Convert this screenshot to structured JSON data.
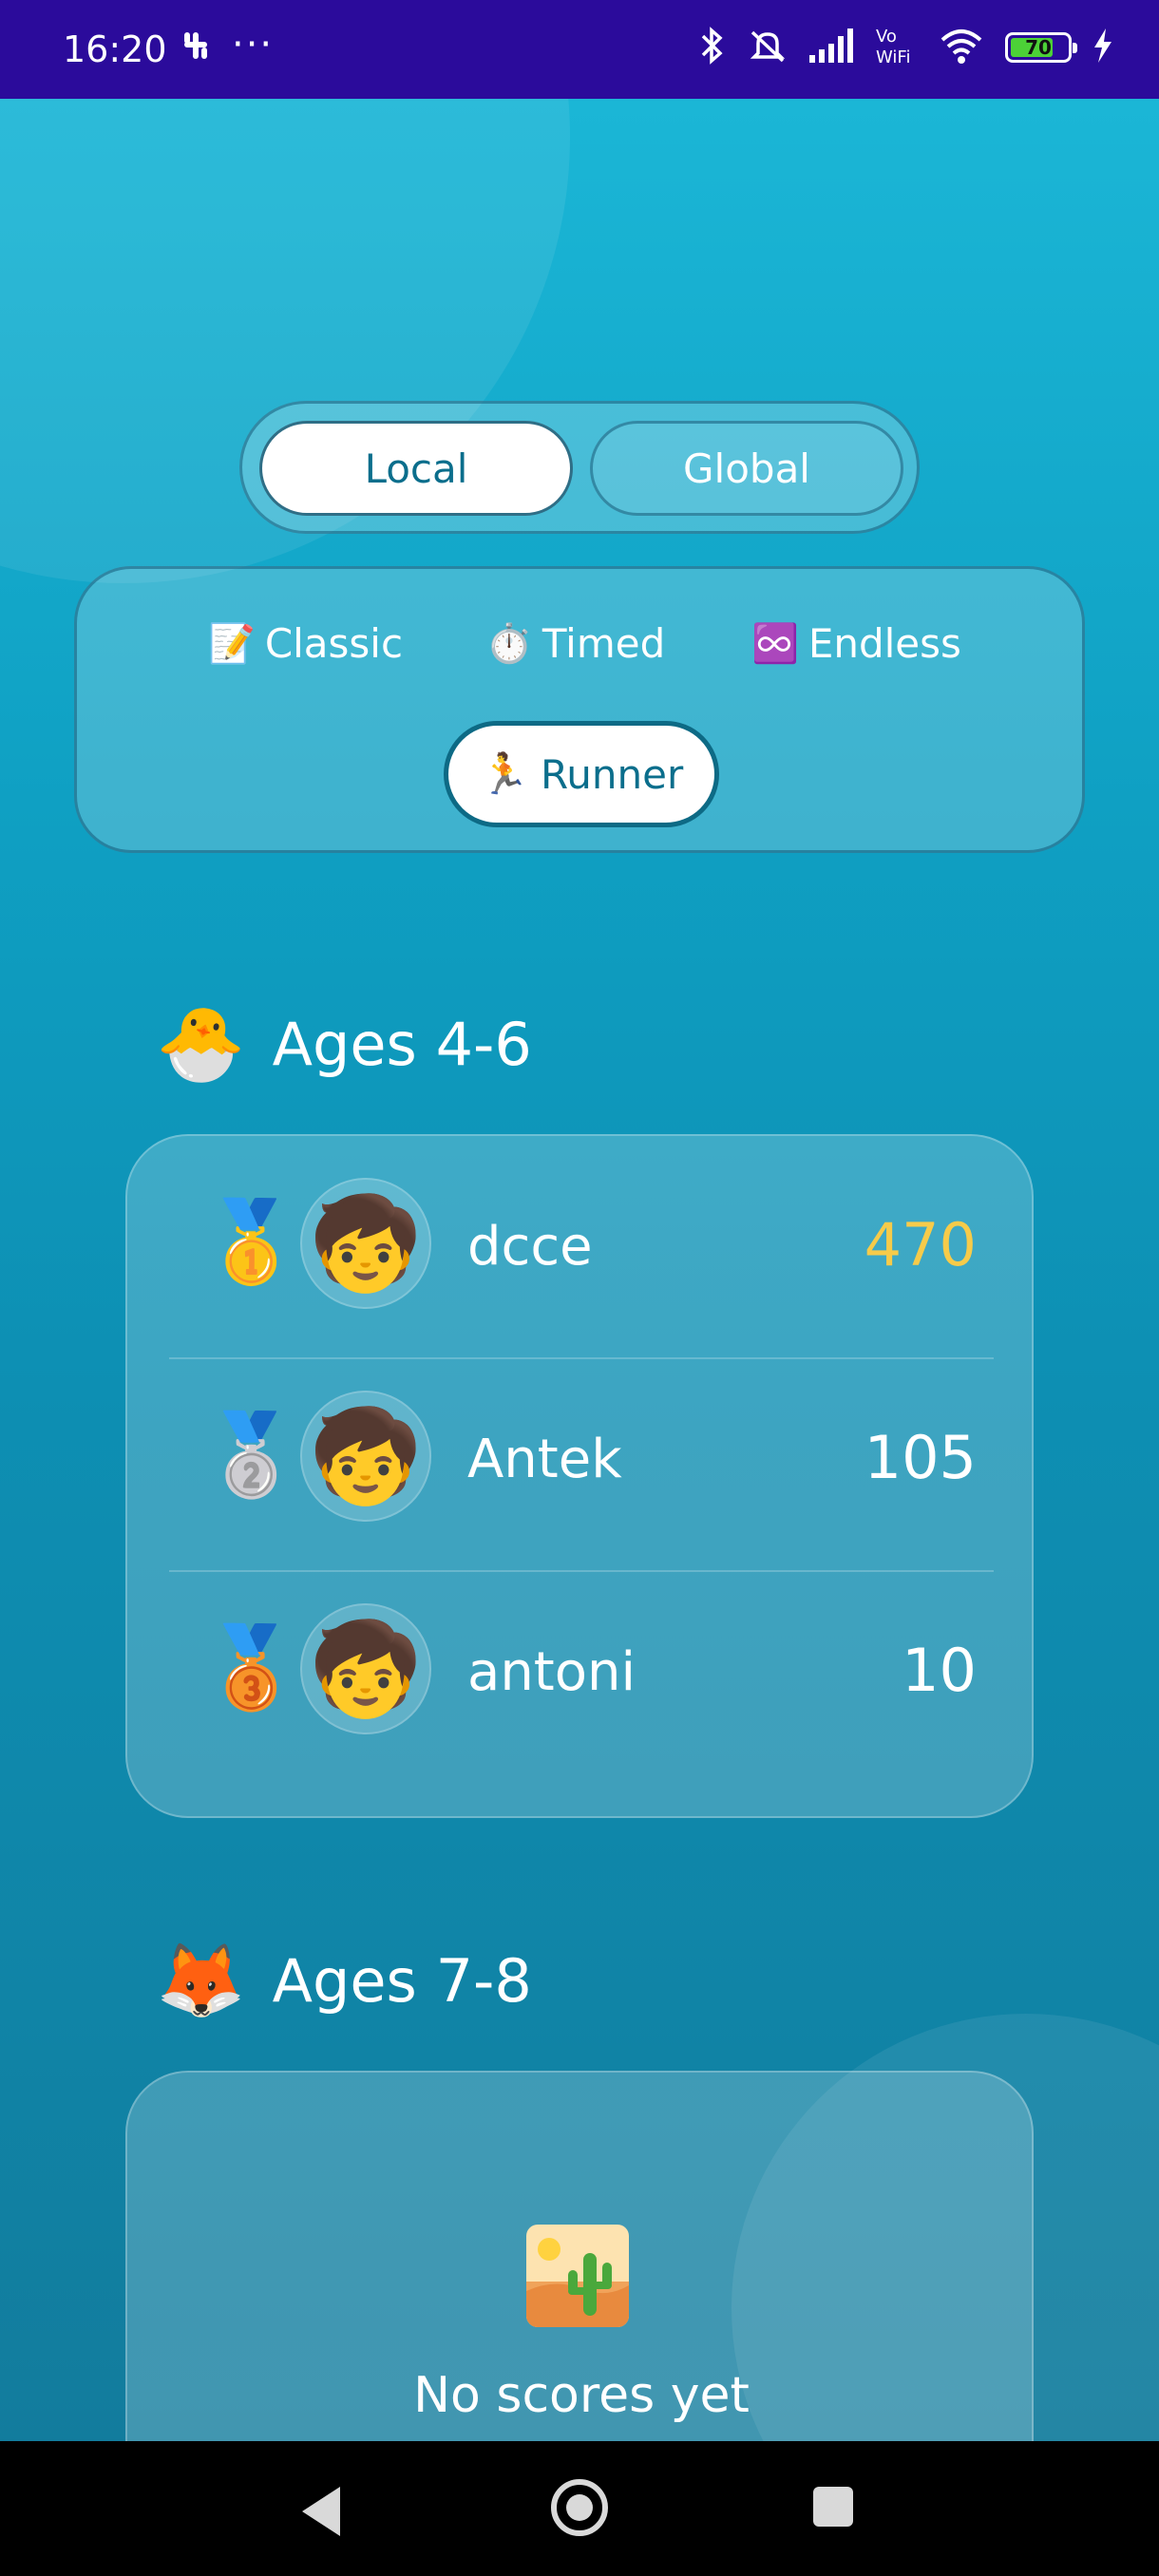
{
  "status_bar": {
    "time": "16:20",
    "overflow": "···",
    "battery": "70"
  },
  "toggle": {
    "local": "Local",
    "global": "Global"
  },
  "modes": [
    {
      "icon": "📝",
      "label": "Classic"
    },
    {
      "icon": "⏱️",
      "label": "Timed"
    },
    {
      "icon": "♾️",
      "label": "Endless"
    },
    {
      "icon": "🏃",
      "label": "Runner"
    }
  ],
  "sections": [
    {
      "icon": "🐣",
      "title": "Ages 4-6",
      "entries": [
        {
          "medal": "🥇",
          "avatar": "🧒",
          "name": "dcce",
          "score": "470"
        },
        {
          "medal": "🥈",
          "avatar": "🧒",
          "name": "Antek",
          "score": "105"
        },
        {
          "medal": "🥉",
          "avatar": "🧒",
          "name": "antoni",
          "score": "10"
        }
      ]
    },
    {
      "icon": "🦊",
      "title": "Ages 7-8",
      "empty_icon": "🏜️",
      "empty_text": "No scores yet"
    }
  ],
  "colors": {
    "status_bar": "#2b0b9b",
    "accent": "#0b6e8c",
    "gold_score": "#f6cb4a"
  }
}
